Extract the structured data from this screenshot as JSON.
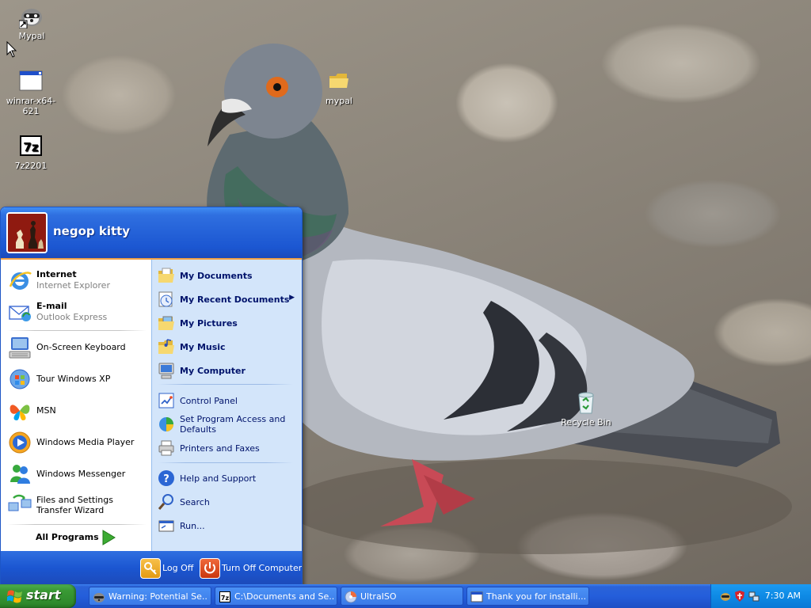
{
  "desktop": {
    "icons": [
      {
        "label": "Mypal",
        "icon": "mypal-raccoon-icon"
      },
      {
        "label": "winrar-x64-621",
        "icon": "installer-window-icon"
      },
      {
        "label": "7z2201",
        "icon": "7zip-icon"
      },
      {
        "label": "mypal",
        "icon": "folder-icon"
      },
      {
        "label": "Recycle Bin",
        "icon": "recycle-bin-icon"
      }
    ]
  },
  "start_menu": {
    "user_name": "negop kitty",
    "pinned": [
      {
        "title": "Internet",
        "subtitle": "Internet Explorer",
        "icon": "internet-explorer-icon"
      },
      {
        "title": "E-mail",
        "subtitle": "Outlook Express",
        "icon": "outlook-express-icon"
      }
    ],
    "recent": [
      {
        "label": "On-Screen Keyboard",
        "icon": "keyboard-icon"
      },
      {
        "label": "Tour Windows XP",
        "icon": "tour-icon"
      },
      {
        "label": "MSN",
        "icon": "msn-butterfly-icon"
      },
      {
        "label": "Windows Media Player",
        "icon": "media-player-icon"
      },
      {
        "label": "Windows Messenger",
        "icon": "messenger-icon"
      },
      {
        "label": "Files and Settings Transfer Wizard",
        "icon": "transfer-wizard-icon"
      }
    ],
    "all_programs": "All Programs",
    "places": [
      {
        "label": "My Documents",
        "icon": "documents-folder-icon"
      },
      {
        "label": "My Recent Documents",
        "icon": "recent-documents-icon"
      },
      {
        "label": "My Pictures",
        "icon": "pictures-folder-icon"
      },
      {
        "label": "My Music",
        "icon": "music-folder-icon"
      },
      {
        "label": "My Computer",
        "icon": "computer-icon"
      }
    ],
    "system": [
      {
        "label": "Control Panel",
        "icon": "control-panel-icon"
      },
      {
        "label": "Set Program Access and Defaults",
        "icon": "program-defaults-icon"
      },
      {
        "label": "Printers and Faxes",
        "icon": "printer-icon"
      }
    ],
    "help": [
      {
        "label": "Help and Support",
        "icon": "help-icon"
      },
      {
        "label": "Search",
        "icon": "search-icon"
      },
      {
        "label": "Run...",
        "icon": "run-icon"
      }
    ],
    "log_off": "Log Off",
    "turn_off": "Turn Off Computer"
  },
  "taskbar": {
    "start_label": "start",
    "tasks": [
      {
        "label": "Warning: Potential Se...",
        "icon": "raccoon-icon"
      },
      {
        "label": "C:\\Documents and Se...",
        "icon": "7zip-icon"
      },
      {
        "label": "UltraISO",
        "icon": "ultraiso-disc-icon"
      },
      {
        "label": "Thank you for installi...",
        "icon": "installer-window-icon"
      }
    ],
    "clock": "7:30 AM"
  },
  "colors": {
    "xp_blue": "#245edb",
    "start_green": "#3a9a35",
    "menu_orange": "#f2a045",
    "right_pane": "#d3e5fa"
  }
}
